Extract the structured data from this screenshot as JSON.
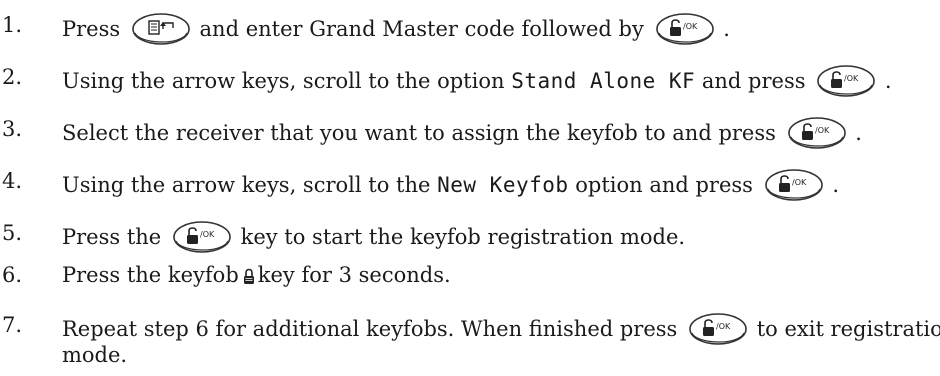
{
  "steps": [
    {
      "num": "1.",
      "a": "Press",
      "b": "and enter Grand Master code followed by",
      "c": "."
    },
    {
      "num": "2.",
      "a": "Using the arrow keys, scroll to the option",
      "code": "Stand Alone KF",
      "b": "and press",
      "c": "."
    },
    {
      "num": "3.",
      "a": "Select the receiver that you want to assign the keyfob to and press",
      "c": "."
    },
    {
      "num": "4.",
      "a": "Using the arrow keys, scroll to the",
      "code": "New Keyfob",
      "b": "option and press",
      "c": "."
    },
    {
      "num": "5.",
      "a": "Press the",
      "b": "key to start the keyfob registration mode."
    },
    {
      "num": "6.",
      "a": "Press the keyfob",
      "b": "key for 3 seconds."
    },
    {
      "num": "7.",
      "a": "Repeat step 6 for additional keyfobs. When finished press",
      "b": "to exit registration",
      "c": "mode."
    }
  ],
  "icons": {
    "menu_key": "menu-back-key-icon",
    "ok_key": "unlock-ok-key-icon",
    "ok_key_label": "/OK",
    "padlock": "padlock-icon"
  }
}
